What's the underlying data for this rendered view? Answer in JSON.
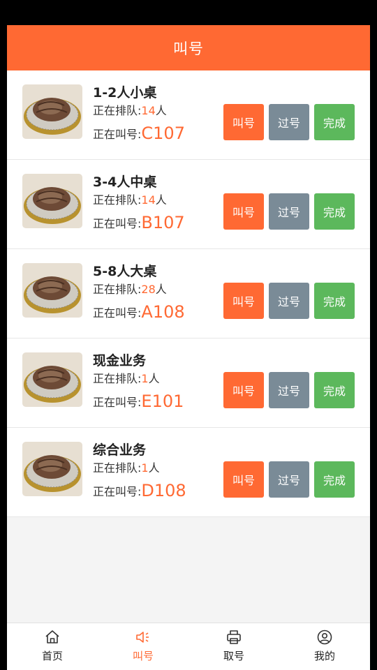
{
  "header": {
    "title": "叫号"
  },
  "queues": [
    {
      "name": "1-2人小桌",
      "queue_prefix": "正在排队:",
      "queue_count": "14",
      "queue_unit": "人",
      "calling_prefix": "正在叫号:",
      "calling_code": "C107"
    },
    {
      "name": "3-4人中桌",
      "queue_prefix": "正在排队:",
      "queue_count": "14",
      "queue_unit": "人",
      "calling_prefix": "正在叫号:",
      "calling_code": "B107"
    },
    {
      "name": "5-8人大桌",
      "queue_prefix": "正在排队:",
      "queue_count": "28",
      "queue_unit": "人",
      "calling_prefix": "正在叫号:",
      "calling_code": "A108"
    },
    {
      "name": "现金业务",
      "queue_prefix": "正在排队:",
      "queue_count": "1",
      "queue_unit": "人",
      "calling_prefix": "正在叫号:",
      "calling_code": "E101"
    },
    {
      "name": "综合业务",
      "queue_prefix": "正在排队:",
      "queue_count": "1",
      "queue_unit": "人",
      "calling_prefix": "正在叫号:",
      "calling_code": "D108"
    }
  ],
  "buttons": {
    "call": "叫号",
    "skip": "过号",
    "done": "完成"
  },
  "tabbar": {
    "items": [
      {
        "label": "首页",
        "icon": "home-icon"
      },
      {
        "label": "叫号",
        "icon": "speaker-icon"
      },
      {
        "label": "取号",
        "icon": "printer-icon"
      },
      {
        "label": "我的",
        "icon": "user-icon"
      }
    ],
    "active_index": 1
  },
  "colors": {
    "accent": "#ff6933",
    "skip": "#7a8b97",
    "done": "#5cb85c"
  }
}
